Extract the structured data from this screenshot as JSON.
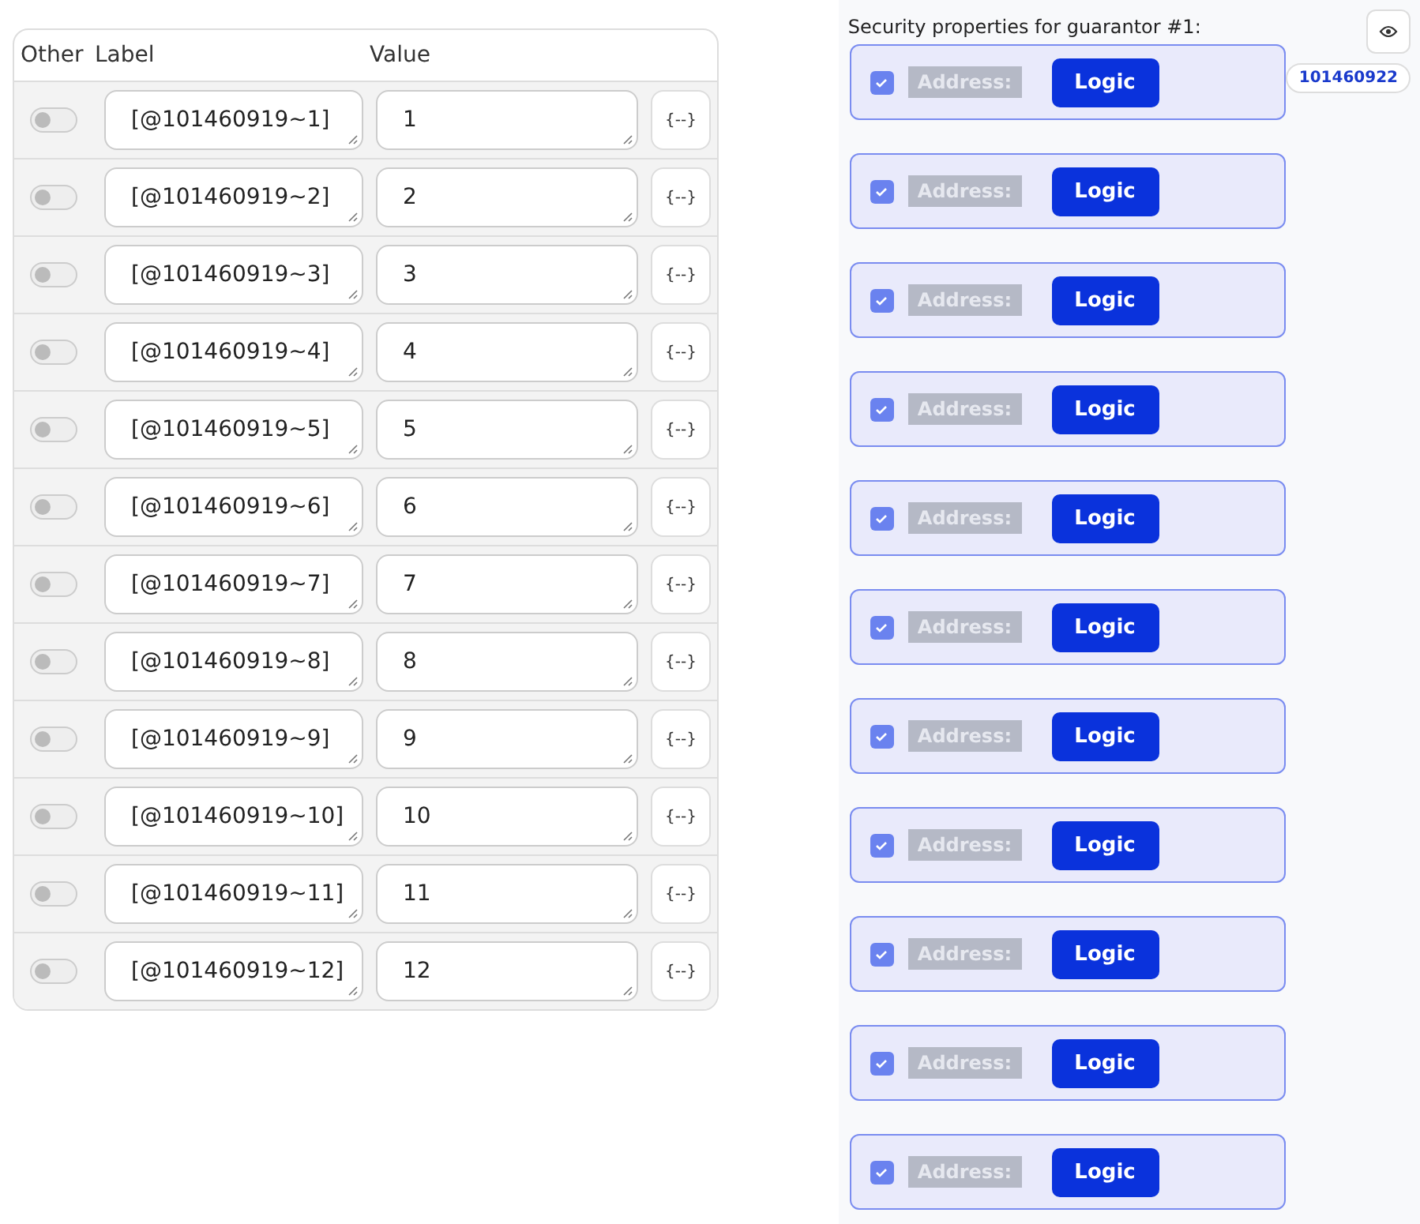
{
  "table": {
    "columns": [
      "Other",
      "Label",
      "Value"
    ],
    "rows": [
      {
        "other_on": false,
        "label": "[@101460919~1]",
        "value": "1",
        "action": "{--}"
      },
      {
        "other_on": false,
        "label": "[@101460919~2]",
        "value": "2",
        "action": "{--}"
      },
      {
        "other_on": false,
        "label": "[@101460919~3]",
        "value": "3",
        "action": "{--}"
      },
      {
        "other_on": false,
        "label": "[@101460919~4]",
        "value": "4",
        "action": "{--}"
      },
      {
        "other_on": false,
        "label": "[@101460919~5]",
        "value": "5",
        "action": "{--}"
      },
      {
        "other_on": false,
        "label": "[@101460919~6]",
        "value": "6",
        "action": "{--}"
      },
      {
        "other_on": false,
        "label": "[@101460919~7]",
        "value": "7",
        "action": "{--}"
      },
      {
        "other_on": false,
        "label": "[@101460919~8]",
        "value": "8",
        "action": "{--}"
      },
      {
        "other_on": false,
        "label": "[@101460919~9]",
        "value": "9",
        "action": "{--}"
      },
      {
        "other_on": false,
        "label": "[@101460919~10]",
        "value": "10",
        "action": "{--}"
      },
      {
        "other_on": false,
        "label": "[@101460919~11]",
        "value": "11",
        "action": "{--}"
      },
      {
        "other_on": false,
        "label": "[@101460919~12]",
        "value": "12",
        "action": "{--}"
      }
    ]
  },
  "security": {
    "title": "Security properties for guarantor #1:",
    "badge": "101460922",
    "cards": [
      {
        "checked": true,
        "label": "Address:",
        "button": "Logic"
      },
      {
        "checked": true,
        "label": "Address:",
        "button": "Logic"
      },
      {
        "checked": true,
        "label": "Address:",
        "button": "Logic"
      },
      {
        "checked": true,
        "label": "Address:",
        "button": "Logic"
      },
      {
        "checked": true,
        "label": "Address:",
        "button": "Logic"
      },
      {
        "checked": true,
        "label": "Address:",
        "button": "Logic"
      },
      {
        "checked": true,
        "label": "Address:",
        "button": "Logic"
      },
      {
        "checked": true,
        "label": "Address:",
        "button": "Logic"
      },
      {
        "checked": true,
        "label": "Address:",
        "button": "Logic"
      },
      {
        "checked": true,
        "label": "Address:",
        "button": "Logic"
      },
      {
        "checked": true,
        "label": "Address:",
        "button": "Logic"
      }
    ]
  }
}
